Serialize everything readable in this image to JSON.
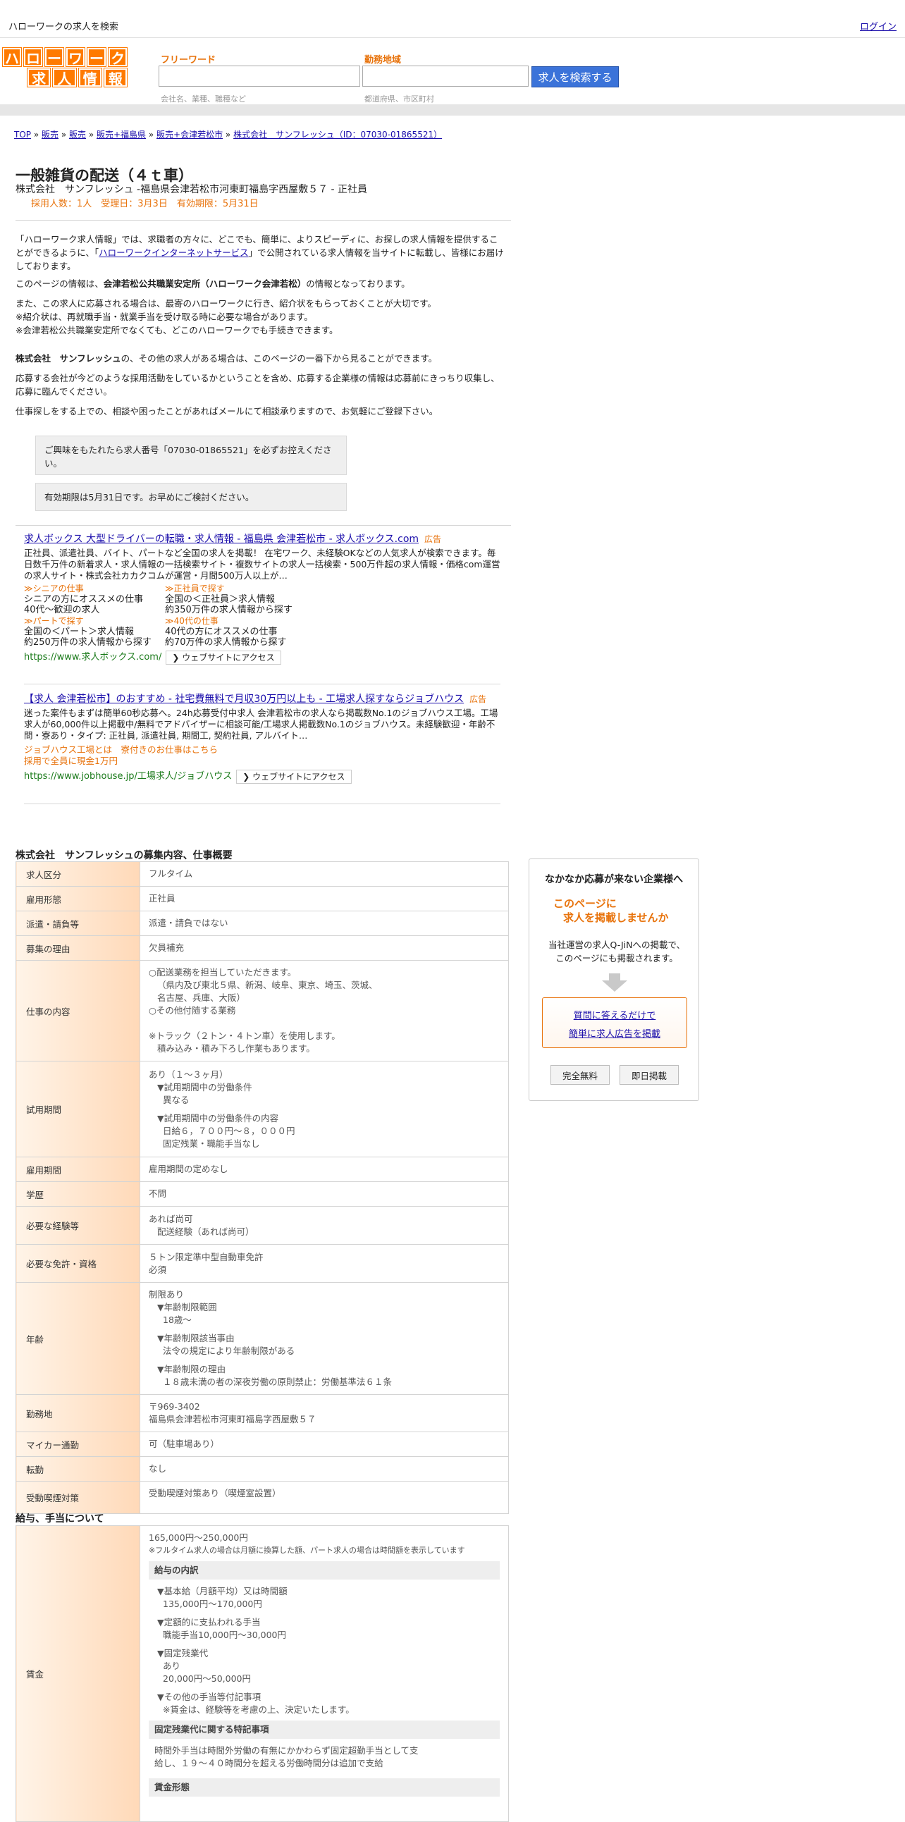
{
  "topbar": {
    "tagline": "ハローワークの求人を検索",
    "login": "ログイン"
  },
  "logo": {
    "row1": [
      "ハ",
      "ロ",
      "ー",
      "ワ",
      "ー",
      "ク"
    ],
    "row2": [
      "求",
      "人",
      "情",
      "報"
    ]
  },
  "search": {
    "keyword_label": "フリーワード",
    "keyword_placeholder": "会社名、業種、職種など",
    "area_label": "勤務地域",
    "area_placeholder": "都道府県、市区町村",
    "button": "求人を検索する"
  },
  "breadcrumb": {
    "items": [
      "TOP",
      "販売",
      "販売",
      "販売+福島県",
      "販売+会津若松市",
      "株式会社　サンフレッシュ（ID：07030-01865521）"
    ],
    "sep": " » "
  },
  "job": {
    "title": "一般雑貨の配送（４ｔ車）",
    "subtitle": "株式会社　サンフレッシュ -福島県会津若松市河東町福島字西屋敷５７ - 正社員",
    "meta": "採用人数：1人　受理日：3月3日　有効期限：5月31日"
  },
  "intro": {
    "p1_a": "「ハローワーク求人情報」では、求職者の方々に、どこでも、簡単に、よりスピーディに、お探しの求人情報を提供することができるように、「",
    "p1_link": "ハローワークインターネットサービス",
    "p1_b": "」で公開されている求人情報を当サイトに転載し、皆様にお届けしております。",
    "p2_a": "このページの情報は、",
    "p2_b": "会津若松公共職業安定所（ハローワーク会津若松）",
    "p2_c": "の情報となっております。",
    "p3_1": "また、この求人に応募される場合は、最寄のハローワークに行き、紹介状をもらっておくことが大切です。",
    "p3_2": "※紹介状は、再就職手当・就業手当を受け取る時に必要な場合があります。",
    "p3_3": "※会津若松公共職業安定所でなくても、どこのハローワークでも手続きできます。",
    "p4_a": "株式会社　サンフレッシュ",
    "p4_b": "の、その他の求人がある場合は、このページの一番下から見ることができます。",
    "p5": "応募する会社が今どのような採用活動をしているかということを含め、応募する企業様の情報は応募前にきっちり収集し、応募に臨んでください。",
    "p6": "仕事探しをする上での、相談や困ったことがあればメールにて相談承りますので、お気軽にご登録下さい。"
  },
  "notices": {
    "n1": "ご興味をもたれたら求人番号「07030-01865521」を必ずお控えください。",
    "n2": "有効期限は5月31日です。お早めにご検討ください。"
  },
  "ads": [
    {
      "title": "求人ボックス 大型ドライバーの転職・求人情報 - 福島県 会津若松市 - 求人ボックス.com",
      "badge": "広告",
      "desc": "正社員、派遣社員、バイト、パートなど全国の求人を掲載！ 在宅ワーク、未経験OKなどの人気求人が検索できます。毎日数千万件の新着求人・求人情報の一括検索サイト・複数サイトの求人一括検索・500万件超の求人情報・価格com運営の求人サイト・株式会社カカクコムが運営・月間500万人以上が…",
      "sitelinks": [
        {
          "title": "≫シニアの仕事",
          "l1": "シニアの方にオススメの仕事",
          "l2": "40代～歓迎の求人"
        },
        {
          "title": "≫正社員で探す",
          "l1": "全国の＜正社員＞求人情報",
          "l2": "約350万件の求人情報から探す"
        },
        {
          "title": "≫パートで探す",
          "l1": "全国の＜パート＞求人情報",
          "l2": "約250万件の求人情報から探す"
        },
        {
          "title": "≫40代の仕事",
          "l1": "40代の方にオススメの仕事",
          "l2": "約70万件の求人情報から探す"
        }
      ],
      "url": "https://www.求人ボックス.com/",
      "visit": "❯ ウェブサイトにアクセス"
    },
    {
      "title": "【求人 会津若松市】のおすすめ - 社宅費無料で月収30万円以上も - 工場求人探すならジョブハウス",
      "badge": "広告",
      "desc": "迷った案件もまずは簡単60秒応募へ。24h応募受付中求人 会津若松市の求人なら掲載数No.1のジョブハウス工場。工場求人が60,000件以上掲載中/無料でアドバイザーに相談可能/工場求人掲載数No.1のジョブハウス。未経験歓迎・年齢不問・寮あり・タイプ: 正社員, 派遣社員, 期間工, 契約社員, アルバイト…",
      "extra1": "ジョブハウス工場とは　寮付きのお仕事はこちら",
      "extra2": "採用で全員に現金1万円",
      "url": "https://www.jobhouse.jp/工場求人/ジョブハウス",
      "visit": "❯ ウェブサイトにアクセス"
    }
  ],
  "section1": {
    "heading": "株式会社　サンフレッシュの募集内容、仕事概要",
    "rows": {
      "kyujin_kubun": {
        "k": "求人区分",
        "v": "フルタイム"
      },
      "koyo_keitai": {
        "k": "雇用形態",
        "v": "正社員"
      },
      "haken": {
        "k": "派遣・請負等",
        "v": "派遣・請負ではない"
      },
      "riyu": {
        "k": "募集の理由",
        "v": "欠員補充"
      },
      "naiyo": {
        "k": "仕事の内容",
        "l1": "○配送業務を担当していただきます。",
        "l2": "（県内及び東北５県、新潟、岐阜、東京、埼玉、茨城、",
        "l3": "名古屋、兵庫、大阪）",
        "l4": "○その他付随する業務",
        "l5": "※トラック（２トン・４トン車）を使用します。",
        "l6": "積み込み・積み下ろし作業もあります。"
      },
      "shiyo": {
        "k": "試用期間",
        "l1": "あり（１～３ヶ月）",
        "l2": "▼試用期間中の労働条件",
        "l3": "異なる",
        "l4": "▼試用期間中の労働条件の内容",
        "l5": "日給６，７００円～８，０００円",
        "l6": "固定残業・職能手当なし"
      },
      "koyo_kikan": {
        "k": "雇用期間",
        "v": "雇用期間の定めなし"
      },
      "gakureki": {
        "k": "学歴",
        "v": "不問"
      },
      "keiken": {
        "k": "必要な経験等",
        "l1": "あれば尚可",
        "l2": "配送経験（あれば尚可）"
      },
      "menkyo": {
        "k": "必要な免許・資格",
        "l1": "５トン限定準中型自動車免許",
        "l2": "必須"
      },
      "nenrei": {
        "k": "年齢",
        "l1": "制限あり",
        "l2": "▼年齢制限範囲",
        "l3": "18歳〜",
        "l4": "▼年齢制限該当事由",
        "l5": "法令の規定により年齢制限がある",
        "l6": "▼年齢制限の理由",
        "l7": "１８歳未満の者の深夜労働の原則禁止：労働基準法６１条"
      },
      "kinmuchi": {
        "k": "勤務地",
        "l1": "〒969-3402",
        "l2": "福島県会津若松市河東町福島字西屋敷５７"
      },
      "mycar": {
        "k": "マイカー通勤",
        "v": "可（駐車場あり）"
      },
      "tenkin": {
        "k": "転勤",
        "v": "なし"
      },
      "judo": {
        "k": "受動喫煙対策",
        "v": "受動喫煙対策あり（喫煙室設置）"
      }
    }
  },
  "section2": {
    "heading": "給与、手当について",
    "chingin": {
      "k": "賃金",
      "range": "165,000円〜250,000円",
      "note": "※フルタイム求人の場合は月額に換算した額、パート求人の場合は時間額を表示しています",
      "h1": "給与の内訳",
      "b1": "▼基本給（月額平均）又は時間額",
      "b1v": "135,000円〜170,000円",
      "b2": "▼定額的に支払われる手当",
      "b2v": "職能手当10,000円〜30,000円",
      "b3": "▼固定残業代",
      "b3v1": "あり",
      "b3v2": "20,000円〜50,000円",
      "b4": "▼その他の手当等付記事項",
      "b4v": "※賃金は、経験等を考慮の上、決定いたします。",
      "h2": "固定残業代に関する特記事項",
      "h2v1": "時間外手当は時間外労働の有無にかかわらず固定超勤手当として支",
      "h2v2": "給し、１９～４０時間分を超える労働時間分は追加で支給",
      "h3": "賃金形態"
    }
  },
  "side": {
    "heading": "なかなか応募が来ない企業様へ",
    "o1": "このページに",
    "o2": "求人を掲載しませんか",
    "t1": "当社運営の求人Q-JiNへの掲載で、",
    "t2": "このページにも掲載されます。",
    "link1": "質問に答えるだけで",
    "link2": "簡単に求人広告を掲載",
    "btn1": "完全無料",
    "btn2": "即日掲載"
  },
  "colors": {
    "accent": "#e8730c",
    "link": "#1a0dab",
    "button": "#3b73d9",
    "url_green": "#1a7a1a"
  }
}
